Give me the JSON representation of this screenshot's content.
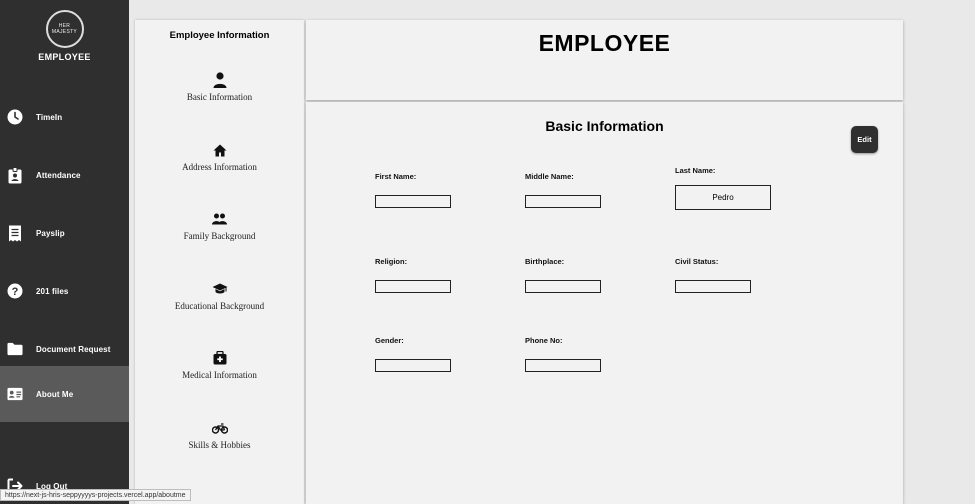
{
  "brand": {
    "logo_line1": "HER",
    "logo_line2": "MAJESTY",
    "title": "EMPLOYEE"
  },
  "nav": [
    {
      "label": "TimeIn",
      "icon": "clock-icon"
    },
    {
      "label": "Attendance",
      "icon": "badge-icon"
    },
    {
      "label": "Payslip",
      "icon": "receipt-icon"
    },
    {
      "label": "201 files",
      "icon": "help-circle-icon"
    },
    {
      "label": "Document Request",
      "icon": "folder-icon"
    },
    {
      "label": "About Me",
      "icon": "id-card-icon",
      "active": true
    },
    {
      "label": "Log Out",
      "icon": "logout-icon"
    }
  ],
  "info_panel": {
    "title": "Employee Information",
    "items": [
      {
        "label": "Basic Information",
        "icon": "person-icon"
      },
      {
        "label": "Address Information",
        "icon": "home-icon"
      },
      {
        "label": "Family Background",
        "icon": "group-icon"
      },
      {
        "label": "Educational Background",
        "icon": "graduation-cap-icon"
      },
      {
        "label": "Medical Information",
        "icon": "medical-kit-icon"
      },
      {
        "label": "Skills & Hobbies",
        "icon": "bicycle-icon"
      }
    ]
  },
  "header": {
    "title": "EMPLOYEE"
  },
  "basic_info": {
    "title": "Basic Information",
    "edit_label": "Edit",
    "fields": {
      "first_name": {
        "label": "First Name:",
        "value": ""
      },
      "middle_name": {
        "label": "Middle Name:",
        "value": ""
      },
      "last_name": {
        "label": "Last Name:",
        "value": "Pedro"
      },
      "religion": {
        "label": "Religion:",
        "value": ""
      },
      "birthplace": {
        "label": "Birthplace:",
        "value": ""
      },
      "civil_status": {
        "label": "Civil Status:",
        "value": ""
      },
      "gender": {
        "label": "Gender:",
        "value": ""
      },
      "phone_no": {
        "label": "Phone No:",
        "value": ""
      }
    }
  },
  "status_url": "https://next-js-hris-seppyyyys-projects.vercel.app/aboutme"
}
